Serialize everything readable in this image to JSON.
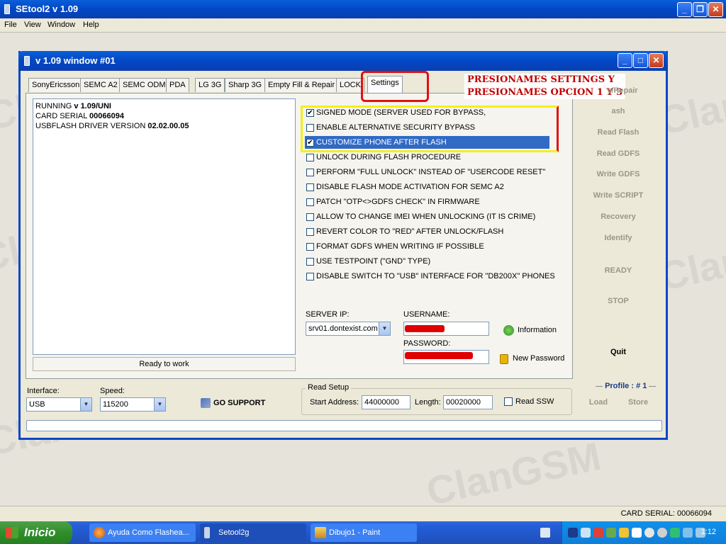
{
  "app": {
    "title": "SEtool2 v 1.09"
  },
  "menu": [
    "File",
    "View",
    "Window",
    "Help"
  ],
  "inner": {
    "title": "v 1.09 window #01"
  },
  "tabs": [
    "SonyEricsson",
    "SEMC A2",
    "SEMC ODM",
    "PDA",
    "LG 3G",
    "Sharp 3G",
    "Empty Fill & Repair",
    "LOCK",
    "Settings"
  ],
  "log": {
    "l1_a": "RUNNING ",
    "l1_b": "v 1.09/UNI",
    "l2_a": "CARD SERIAL ",
    "l2_b": "00066094",
    "l3_a": "USBFLASH DRIVER VERSION ",
    "l3_b": "02.02.00.05"
  },
  "status_ready": "Ready to work",
  "options": [
    {
      "label": "SIGNED MODE (SERVER USED FOR BYPASS,",
      "checked": "✔"
    },
    {
      "label": "ENABLE ALTERNATIVE SECURITY BYPASS",
      "checked": ""
    },
    {
      "label": "CUSTOMIZE PHONE AFTER FLASH",
      "checked": "✔"
    },
    {
      "label": "UNLOCK DURING FLASH PROCEDURE",
      "checked": ""
    },
    {
      "label": "PERFORM \"FULL UNLOCK\" INSTEAD OF \"USERCODE RESET\"",
      "checked": ""
    },
    {
      "label": "DISABLE FLASH MODE ACTIVATION FOR SEMC A2",
      "checked": ""
    },
    {
      "label": "PATCH \"OTP<>GDFS CHECK\" IN FIRMWARE",
      "checked": ""
    },
    {
      "label": "ALLOW TO CHANGE IMEI WHEN UNLOCKING (IT IS CRIME)",
      "checked": ""
    },
    {
      "label": "REVERT COLOR TO \"RED\" AFTER UNLOCK/FLASH",
      "checked": ""
    },
    {
      "label": "FORMAT GDFS WHEN WRITING IF POSSIBLE",
      "checked": ""
    },
    {
      "label": "USE TESTPOINT (\"GND\" TYPE)",
      "checked": ""
    },
    {
      "label": "DISABLE SWITCH TO \"USB\" INTERFACE FOR \"DB200X\" PHONES",
      "checked": ""
    }
  ],
  "annotation": {
    "line1": "PRESIONAMES SETTINGS Y",
    "line2": "PRESIONAMES OPCION 1 Y 3"
  },
  "server": {
    "label": "SERVER IP:",
    "value": "srv01.dontexist.com"
  },
  "username": {
    "label": "USERNAME:"
  },
  "password": {
    "label": "PASSWORD:"
  },
  "info_button": "Information",
  "new_password_button": "New Password",
  "side": {
    "b1": "y/Repair",
    "b2": "ash",
    "b3": "Read Flash",
    "b4": "Read GDFS",
    "b5": "Write GDFS",
    "b6": "Write SCRIPT",
    "b7": "Recovery",
    "b8": "Identify",
    "b9": "READY",
    "b10": "STOP",
    "quit": "Quit",
    "profile": "Profile : # 1",
    "load": "Load",
    "store": "Store"
  },
  "interface": {
    "label": "Interface:",
    "value": "USB"
  },
  "speed": {
    "label": "Speed:",
    "value": "115200"
  },
  "go_support": "GO SUPPORT",
  "read_setup": {
    "title": "Read Setup",
    "start_label": "Start Address:",
    "start_value": "44000000",
    "length_label": "Length:",
    "length_value": "00020000",
    "ssw_label": "Read SSW"
  },
  "statusbar": {
    "card_serial": "CARD SERIAL: 00066094"
  },
  "taskbar": {
    "start": "Inicio",
    "t1": "Ayuda Como Flashea...",
    "t2": "Setool2g",
    "t3": "Dibujo1 - Paint",
    "clock": "1:12"
  },
  "colors": {
    "titlebar": "#0247c5",
    "accent_red": "#e01010",
    "highlight_yellow": "#f5ef1a",
    "selected": "#316ac5"
  }
}
